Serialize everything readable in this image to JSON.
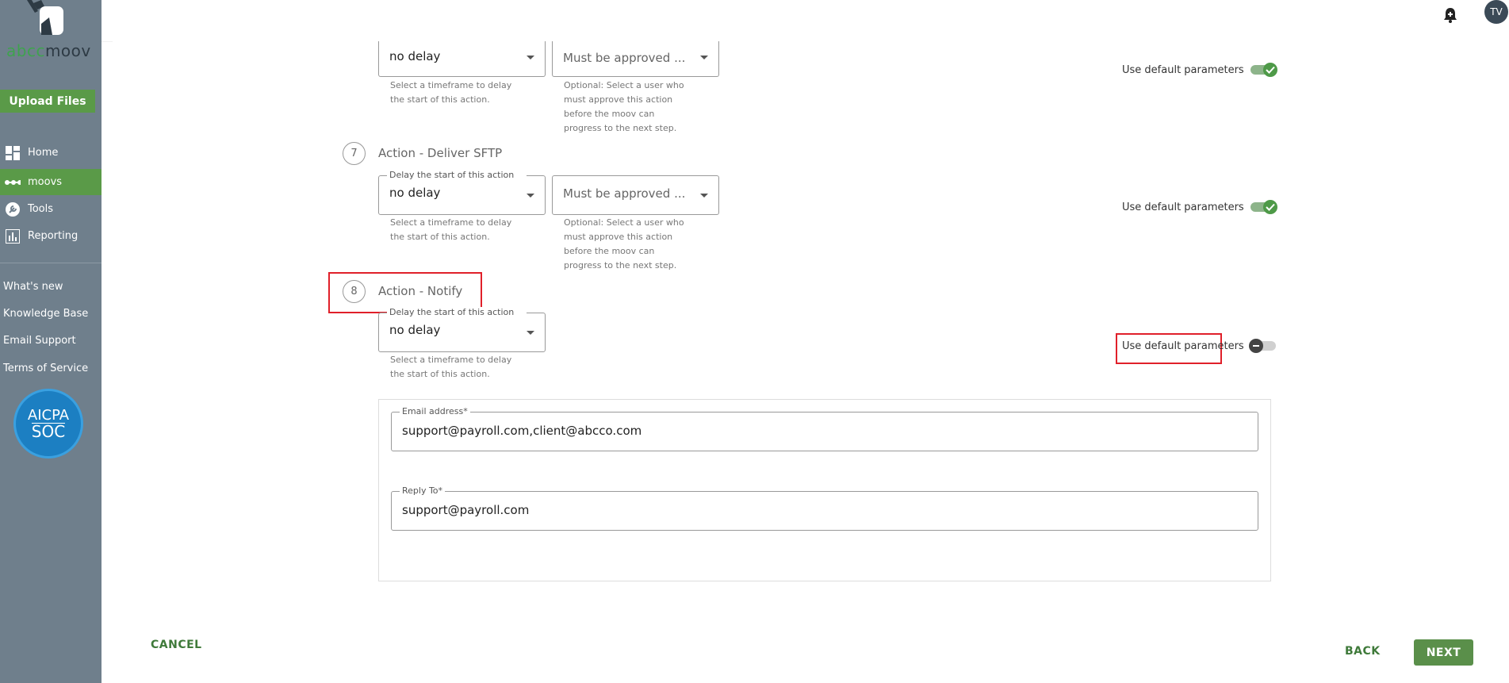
{
  "brand": {
    "logo_part1": "abcc",
    "logo_part2": "moov"
  },
  "sidebar": {
    "upload_label": "Upload Files",
    "nav": [
      {
        "label": "Home",
        "icon": "dashboard-icon"
      },
      {
        "label": "moovs",
        "icon": "dots-icon"
      },
      {
        "label": "Tools",
        "icon": "wrench-icon"
      },
      {
        "label": "Reporting",
        "icon": "chart-icon"
      }
    ],
    "links": [
      "What's new",
      "Knowledge Base",
      "Email Support",
      "Terms of Service"
    ],
    "badge": {
      "line1": "AICPA",
      "line2": "SOC"
    }
  },
  "topbar": {
    "avatar_initials": "TV",
    "bell_icon": "bell-plus-icon"
  },
  "steps": [
    {
      "delay_legend": "Delay the start of this action",
      "delay_value": "no delay",
      "delay_helper": [
        "Select a timeframe to delay",
        "the start of this action."
      ],
      "approver_placeholder": "Must be approved ...",
      "approver_helper": [
        "Optional: Select a user who",
        "must approve this action",
        "before the moov can",
        "progress to the next step."
      ],
      "default_params_label": "Use default parameters"
    },
    {
      "number": "7",
      "title": "Action - Deliver SFTP",
      "delay_legend": "Delay the start of this action",
      "delay_value": "no delay",
      "delay_helper": [
        "Select a timeframe to delay",
        "the start of this action."
      ],
      "approver_placeholder": "Must be approved ...",
      "approver_helper": [
        "Optional: Select a user who",
        "must approve this action",
        "before the moov can",
        "progress to the next step."
      ],
      "default_params_label": "Use default parameters"
    },
    {
      "number": "8",
      "title": "Action - Notify",
      "delay_legend": "Delay the start of this action",
      "delay_value": "no delay",
      "delay_helper": [
        "Select a timeframe to delay",
        "the start of this action."
      ],
      "default_params_label": "Use default parameters",
      "email_legend": "Email address*",
      "email_value": "support@payroll.com,client@abcco.com",
      "reply_legend": "Reply To*",
      "reply_value": "support@payroll.com"
    }
  ],
  "footer": {
    "cancel": "CANCEL",
    "back": "BACK",
    "next": "NEXT"
  },
  "colors": {
    "sidebar": "#6f7f8c",
    "accent": "#5a9a48",
    "highlight": "#e0202a"
  }
}
